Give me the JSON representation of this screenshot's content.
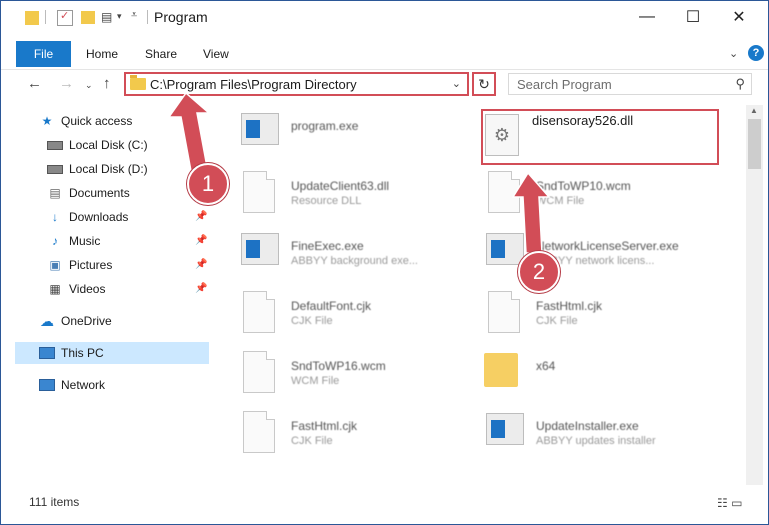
{
  "window": {
    "title": "Program",
    "controls": {
      "minimize": "—",
      "maximize": "☐",
      "close": "✕"
    }
  },
  "ribbon": {
    "tabs": [
      "File",
      "Home",
      "Share",
      "View"
    ],
    "help": "?"
  },
  "nav": {
    "address": "C:\\Program Files\\Program Directory",
    "search_placeholder": "Search Program"
  },
  "sidebar": {
    "items": [
      {
        "label": "Quick access",
        "icon": "star-icon"
      },
      {
        "label": "Local Disk (C:)",
        "icon": "drive-icon"
      },
      {
        "label": "Local Disk (D:)",
        "icon": "drive-icon"
      },
      {
        "label": "Documents",
        "icon": "documents-icon"
      },
      {
        "label": "Downloads",
        "icon": "download-icon"
      },
      {
        "label": "Music",
        "icon": "music-icon"
      },
      {
        "label": "Pictures",
        "icon": "pictures-icon"
      },
      {
        "label": "Videos",
        "icon": "videos-icon"
      },
      {
        "label": "OneDrive",
        "icon": "cloud-icon"
      },
      {
        "label": "This PC",
        "icon": "computer-icon"
      },
      {
        "label": "Network",
        "icon": "network-icon"
      }
    ]
  },
  "files": [
    {
      "name": "program.exe",
      "sub": "",
      "type": "exe"
    },
    {
      "name": "disensoray526.dll",
      "sub": "",
      "type": "dll-highlighted"
    },
    {
      "name": "UpdateClient63.dll",
      "sub": "Resource DLL",
      "type": "doc"
    },
    {
      "name": "SndToWP10.wcm",
      "sub": "WCM File",
      "type": "doc"
    },
    {
      "name": "FineExec.exe",
      "sub": "ABBYY background exe...",
      "type": "exe"
    },
    {
      "name": "NetworkLicenseServer.exe",
      "sub": "ABBYY network licens...",
      "type": "exe"
    },
    {
      "name": "DefaultFont.cjk",
      "sub": "CJK File",
      "type": "doc"
    },
    {
      "name": "FastHtml.cjk",
      "sub": "CJK File",
      "type": "doc"
    },
    {
      "name": "SndToWP16.wcm",
      "sub": "WCM File",
      "type": "doc"
    },
    {
      "name": "x64",
      "sub": "",
      "type": "folder"
    },
    {
      "name": "FastHtml.cjk",
      "sub": "CJK File",
      "type": "doc"
    },
    {
      "name": "UpdateInstaller.exe",
      "sub": "ABBYY updates installer",
      "type": "exe"
    }
  ],
  "status": {
    "count": "111 items"
  },
  "annotations": {
    "step1": "1",
    "step2": "2"
  },
  "colors": {
    "accent": "#1979ca",
    "annotation": "#d24d57",
    "selection": "#cce8ff"
  }
}
